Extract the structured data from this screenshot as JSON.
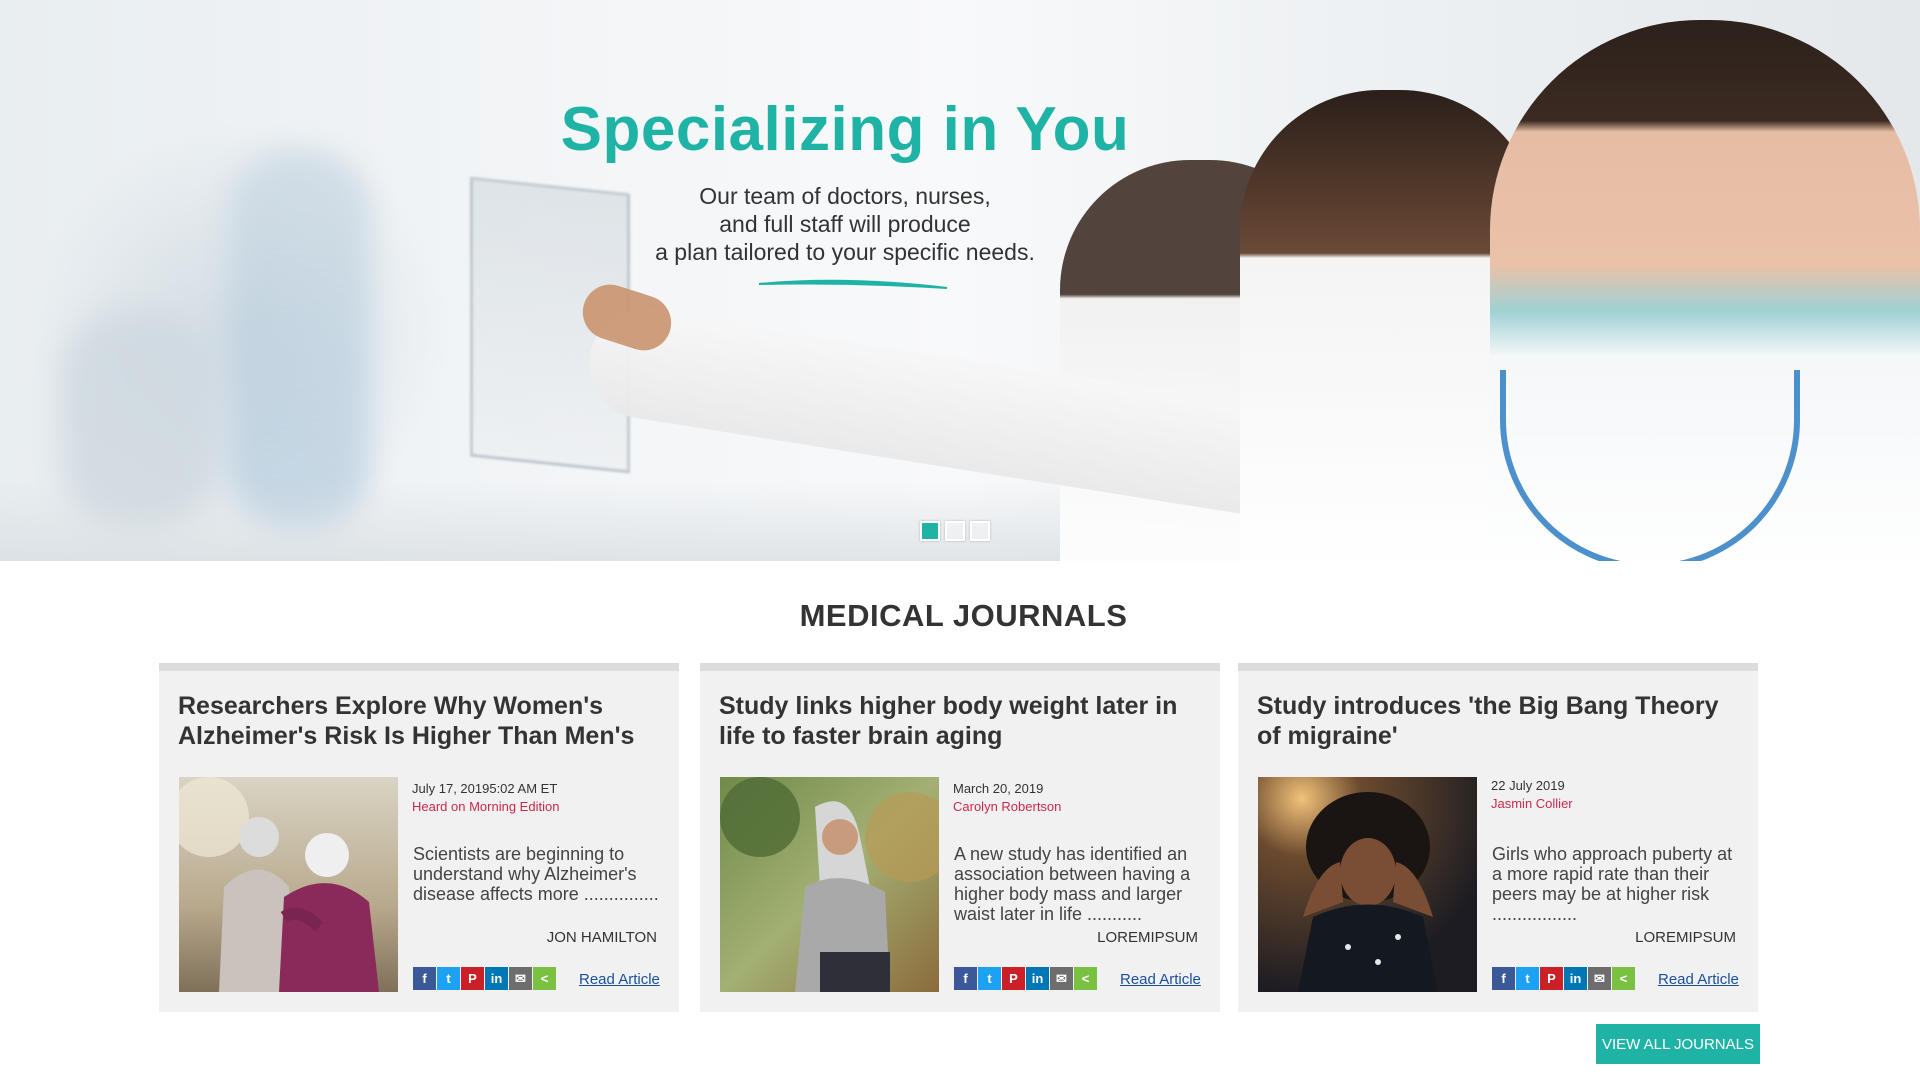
{
  "hero": {
    "title": "Specializing in You",
    "subtitle_lines": [
      "Our team of doctors, nurses,",
      "and full staff will produce",
      "a plan tailored to your specific needs."
    ],
    "slides": 3,
    "active_slide": 1,
    "accent_color": "#1fb3a6"
  },
  "section": {
    "title": "MEDICAL JOURNALS"
  },
  "articles": [
    {
      "title": "Researchers Explore Why Women's Alzheimer's Risk Is Higher Than Men's",
      "date": "July 17, 20195:02 AM ET",
      "source": "Heard on Morning Edition",
      "excerpt": "Scientists are beginning to understand why Alzheimer's disease affects more ...............",
      "byline": "JON HAMILTON",
      "read_label": "Read Article"
    },
    {
      "title": "Study links higher body weight later in life to faster brain aging",
      "date": "March 20, 2019",
      "source": "Carolyn Robertson",
      "excerpt": "A new study has identified an association between having a higher body mass and larger waist later in life ...........",
      "byline": "LOREMIPSUM",
      "read_label": "Read Article"
    },
    {
      "title": "Study introduces 'the Big Bang Theory of migraine'",
      "date": "22 July 2019",
      "source": "Jasmin Collier",
      "excerpt": "Girls who approach puberty at a more rapid rate than their peers may be at higher risk .................",
      "byline": "LOREMIPSUM",
      "read_label": "Read Article"
    }
  ],
  "share_icons": [
    {
      "name": "facebook-icon",
      "glyph": "f",
      "color": "#3b5998"
    },
    {
      "name": "twitter-icon",
      "glyph": "t",
      "color": "#1da1f2"
    },
    {
      "name": "pinterest-icon",
      "glyph": "P",
      "color": "#cb2027"
    },
    {
      "name": "linkedin-icon",
      "glyph": "in",
      "color": "#0077b5"
    },
    {
      "name": "email-icon",
      "glyph": "✉",
      "color": "#6d6d6d"
    },
    {
      "name": "share-icon",
      "glyph": "<",
      "color": "#7ac143"
    }
  ],
  "view_all_label": "VIEW ALL JOURNALS"
}
